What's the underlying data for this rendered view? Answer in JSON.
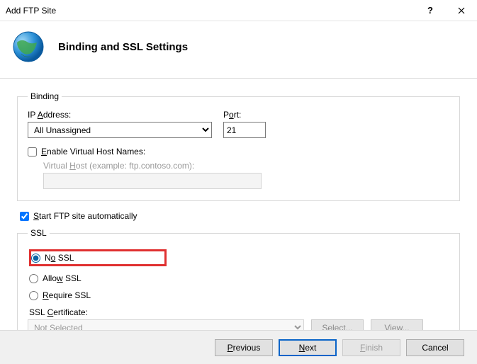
{
  "window": {
    "title": "Add FTP Site"
  },
  "header": {
    "title": "Binding and SSL Settings"
  },
  "binding": {
    "legend": "Binding",
    "ip_label_pre": "IP ",
    "ip_label_u": "A",
    "ip_label_post": "ddress:",
    "ip_value": "All Unassigned",
    "port_label_pre": "P",
    "port_label_u": "o",
    "port_label_post": "rt:",
    "port_value": "21",
    "enable_vhost_pre": "",
    "enable_vhost_u": "E",
    "enable_vhost_post": "nable Virtual Host Names:",
    "vhost_label_pre": "Virtual ",
    "vhost_label_u": "H",
    "vhost_label_post": "ost (example: ftp.contoso.com):"
  },
  "auto_start": {
    "u": "S",
    "post": "tart FTP site automatically"
  },
  "ssl": {
    "legend": "SSL",
    "no_ssl_pre": "N",
    "no_ssl_u": "o",
    "no_ssl_post": " SSL",
    "allow_pre": "Allo",
    "allow_u": "w",
    "allow_post": " SSL",
    "require_u": "R",
    "require_post": "equire SSL",
    "cert_label_pre": "SSL ",
    "cert_label_u": "C",
    "cert_label_post": "ertificate:",
    "cert_value": "Not Selected",
    "select_btn_pre": "Se",
    "select_btn_u": "l",
    "select_btn_post": "ect...",
    "view_btn_pre": "V",
    "view_btn_u": "i",
    "view_btn_post": "ew..."
  },
  "footer": {
    "previous_u": "P",
    "previous_post": "revious",
    "next_u": "N",
    "next_post": "ext",
    "finish_u": "F",
    "finish_post": "inish",
    "cancel": "Cancel"
  }
}
